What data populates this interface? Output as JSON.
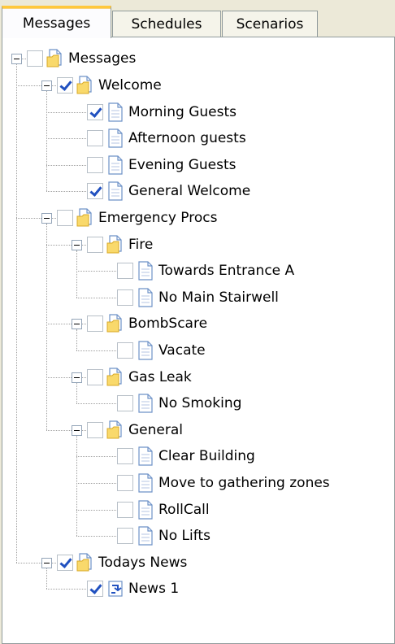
{
  "tabs": [
    {
      "label": "Messages",
      "active": true
    },
    {
      "label": "Schedules",
      "active": false
    },
    {
      "label": "Scenarios",
      "active": false
    }
  ],
  "tree": {
    "nodes": [
      {
        "label": "Messages",
        "level": 0,
        "type": "folder",
        "checked": false,
        "expanded": true,
        "last": true
      },
      {
        "label": "Welcome",
        "level": 1,
        "type": "folder",
        "checked": true,
        "expanded": true,
        "last": false
      },
      {
        "label": "Morning Guests",
        "level": 2,
        "type": "message",
        "checked": true,
        "last": false
      },
      {
        "label": "Afternoon guests",
        "level": 2,
        "type": "message",
        "checked": false,
        "last": false
      },
      {
        "label": "Evening Guests",
        "level": 2,
        "type": "message",
        "checked": false,
        "last": false
      },
      {
        "label": "General Welcome",
        "level": 2,
        "type": "message",
        "checked": true,
        "last": true
      },
      {
        "label": "Emergency Procs",
        "level": 1,
        "type": "folder",
        "checked": false,
        "expanded": true,
        "last": false
      },
      {
        "label": "Fire",
        "level": 2,
        "type": "folder",
        "checked": false,
        "expanded": true,
        "last": false
      },
      {
        "label": "Towards Entrance A",
        "level": 3,
        "type": "message",
        "checked": false,
        "last": false
      },
      {
        "label": "No Main Stairwell",
        "level": 3,
        "type": "message",
        "checked": false,
        "last": true
      },
      {
        "label": "BombScare",
        "level": 2,
        "type": "folder",
        "checked": false,
        "expanded": true,
        "last": false
      },
      {
        "label": "Vacate",
        "level": 3,
        "type": "message",
        "checked": false,
        "last": true
      },
      {
        "label": "Gas Leak",
        "level": 2,
        "type": "folder",
        "checked": false,
        "expanded": true,
        "last": false
      },
      {
        "label": "No Smoking",
        "level": 3,
        "type": "message",
        "checked": false,
        "last": true
      },
      {
        "label": "General",
        "level": 2,
        "type": "folder",
        "checked": false,
        "expanded": true,
        "last": true
      },
      {
        "label": "Clear Building",
        "level": 3,
        "type": "message",
        "checked": false,
        "last": false
      },
      {
        "label": "Move to gathering zones",
        "level": 3,
        "type": "message",
        "checked": false,
        "last": false
      },
      {
        "label": "RollCall",
        "level": 3,
        "type": "message",
        "checked": false,
        "last": false
      },
      {
        "label": "No Lifts",
        "level": 3,
        "type": "message",
        "checked": false,
        "last": true
      },
      {
        "label": "Todays News",
        "level": 1,
        "type": "folder",
        "checked": true,
        "expanded": true,
        "last": true
      },
      {
        "label": "News 1",
        "level": 2,
        "type": "news",
        "checked": true,
        "last": true
      }
    ]
  },
  "colors": {
    "window_bg": "#ECE9D8",
    "tab_highlight": "#FFC83C",
    "check_mark": "#2151C0",
    "folder_yellow": "#F9D96B",
    "doc_blue": "#6E92C8"
  },
  "icons": {
    "folder": "folder-document-icon",
    "message": "document-icon",
    "news": "news-document-icon"
  }
}
